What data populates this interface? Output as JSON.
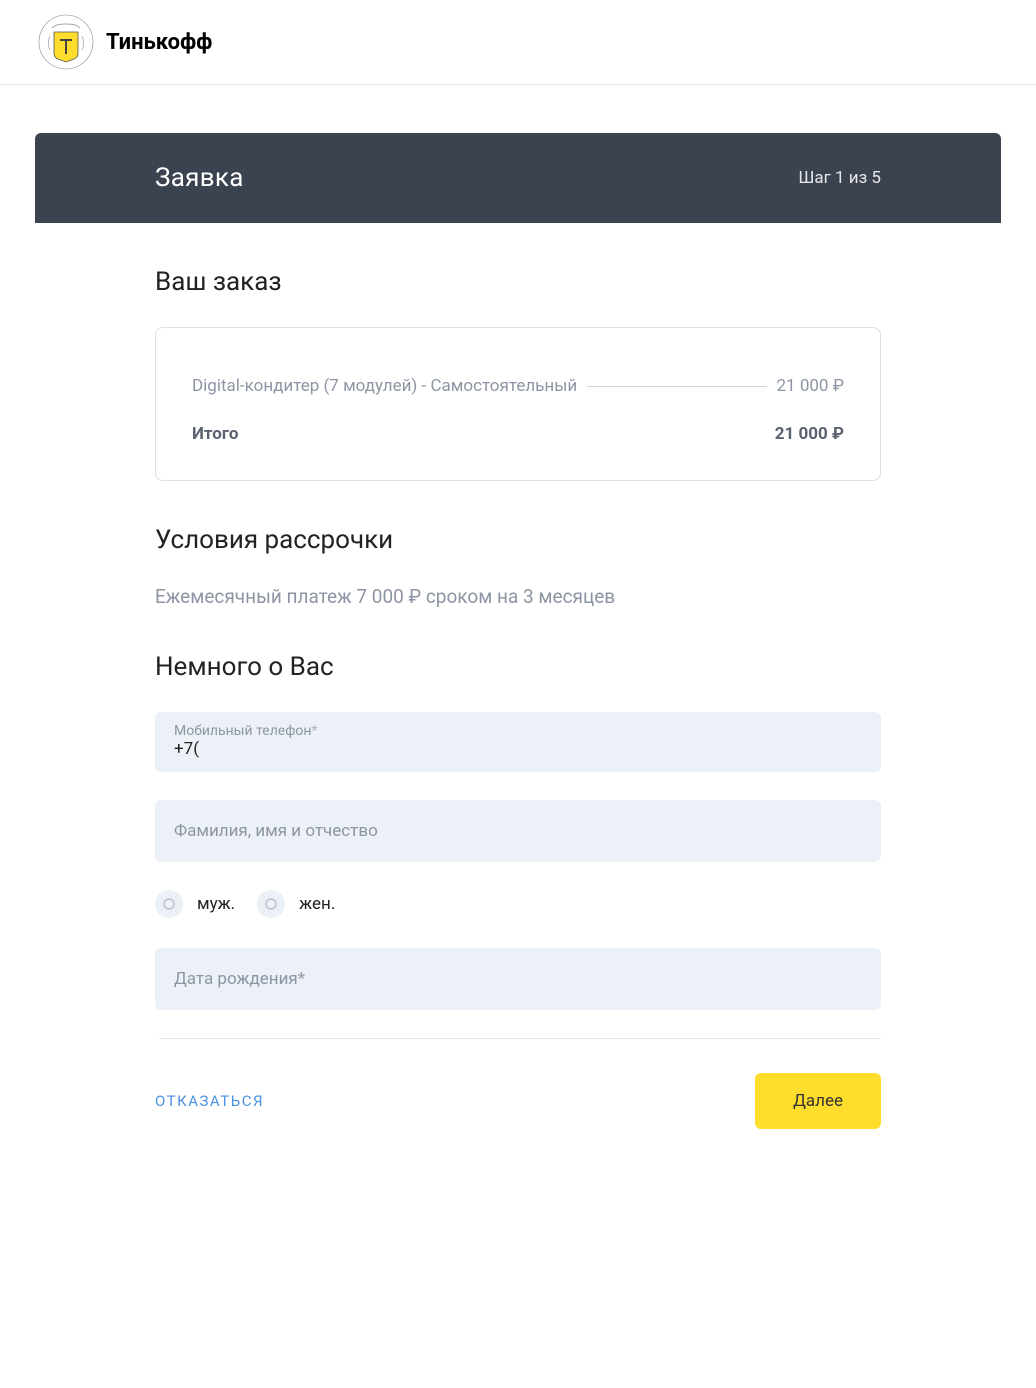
{
  "brand": "Тинькофф",
  "panel": {
    "title": "Заявка",
    "step": "Шаг 1 из 5"
  },
  "order": {
    "heading": "Ваш заказ",
    "item_name": "Digital-кондитер (7 модулей) - Самостоятельный",
    "item_price": "21 000 ₽",
    "total_label": "Итого",
    "total_value": "21 000 ₽"
  },
  "installment": {
    "heading": "Условия рассрочки",
    "desc": "Ежемесячный платеж 7 000 ₽ сроком на 3 месяцев"
  },
  "about": {
    "heading": "Немного о Вас",
    "phone_label": "Мобильный телефон",
    "phone_value": "+7(",
    "fio_placeholder": "Фамилия, имя и отчество",
    "gender_male": "муж.",
    "gender_female": "жен.",
    "dob_label": "Дата рождения"
  },
  "actions": {
    "cancel": "ОТКАЗАТЬСЯ",
    "next": "Далее"
  }
}
